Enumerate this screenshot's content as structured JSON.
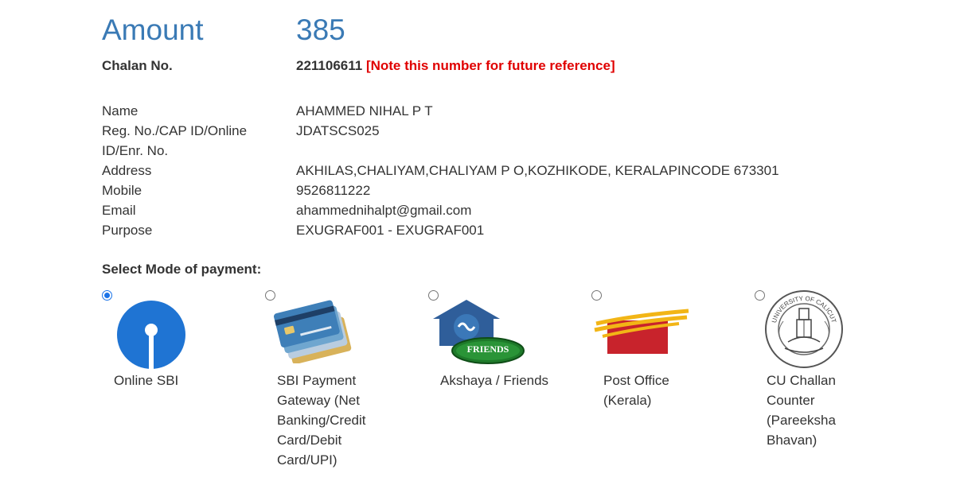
{
  "amount": {
    "label": "Amount",
    "value": "385"
  },
  "chalan": {
    "label": "Chalan No.",
    "number": "221106611",
    "note": "[Note this number for future reference]"
  },
  "details": [
    {
      "label": "Name",
      "value": "AHAMMED NIHAL P T"
    },
    {
      "label": "Reg. No./CAP ID/Online ID/Enr. No.",
      "value": "JDATSCS025"
    },
    {
      "label": "Address",
      "value": "AKHILAS,CHALIYAM,CHALIYAM P O,KOZHIKODE, KERALAPINCODE 673301"
    },
    {
      "label": "Mobile",
      "value": "9526811222"
    },
    {
      "label": "Email",
      "value": "ahammednihalpt@gmail.com"
    },
    {
      "label": "Purpose",
      "value": "EXUGRAF001 - EXUGRAF001"
    }
  ],
  "payment": {
    "heading": "Select Mode of payment:",
    "selected_index": 0,
    "options": [
      {
        "label": "Online SBI",
        "icon": "sbi-logo-icon"
      },
      {
        "label": "SBI Payment Gateway (Net Banking/Credit Card/Debit Card/UPI)",
        "icon": "credit-cards-icon"
      },
      {
        "label": "Akshaya / Friends",
        "icon": "akshaya-friends-logo-icon",
        "logo_text": "FRIENDS"
      },
      {
        "label": "Post Office (Kerala)",
        "icon": "india-post-logo-icon"
      },
      {
        "label": "CU Challan Counter (Pareeksha Bhavan)",
        "icon": "university-of-calicut-seal-icon",
        "logo_text": "UNIVERSITY OF CALICUT"
      }
    ]
  },
  "colors": {
    "accent": "#3a7ab5",
    "note": "#e00000",
    "sbi_blue": "#1f74d3",
    "radio_selected": "#1a73e8"
  }
}
